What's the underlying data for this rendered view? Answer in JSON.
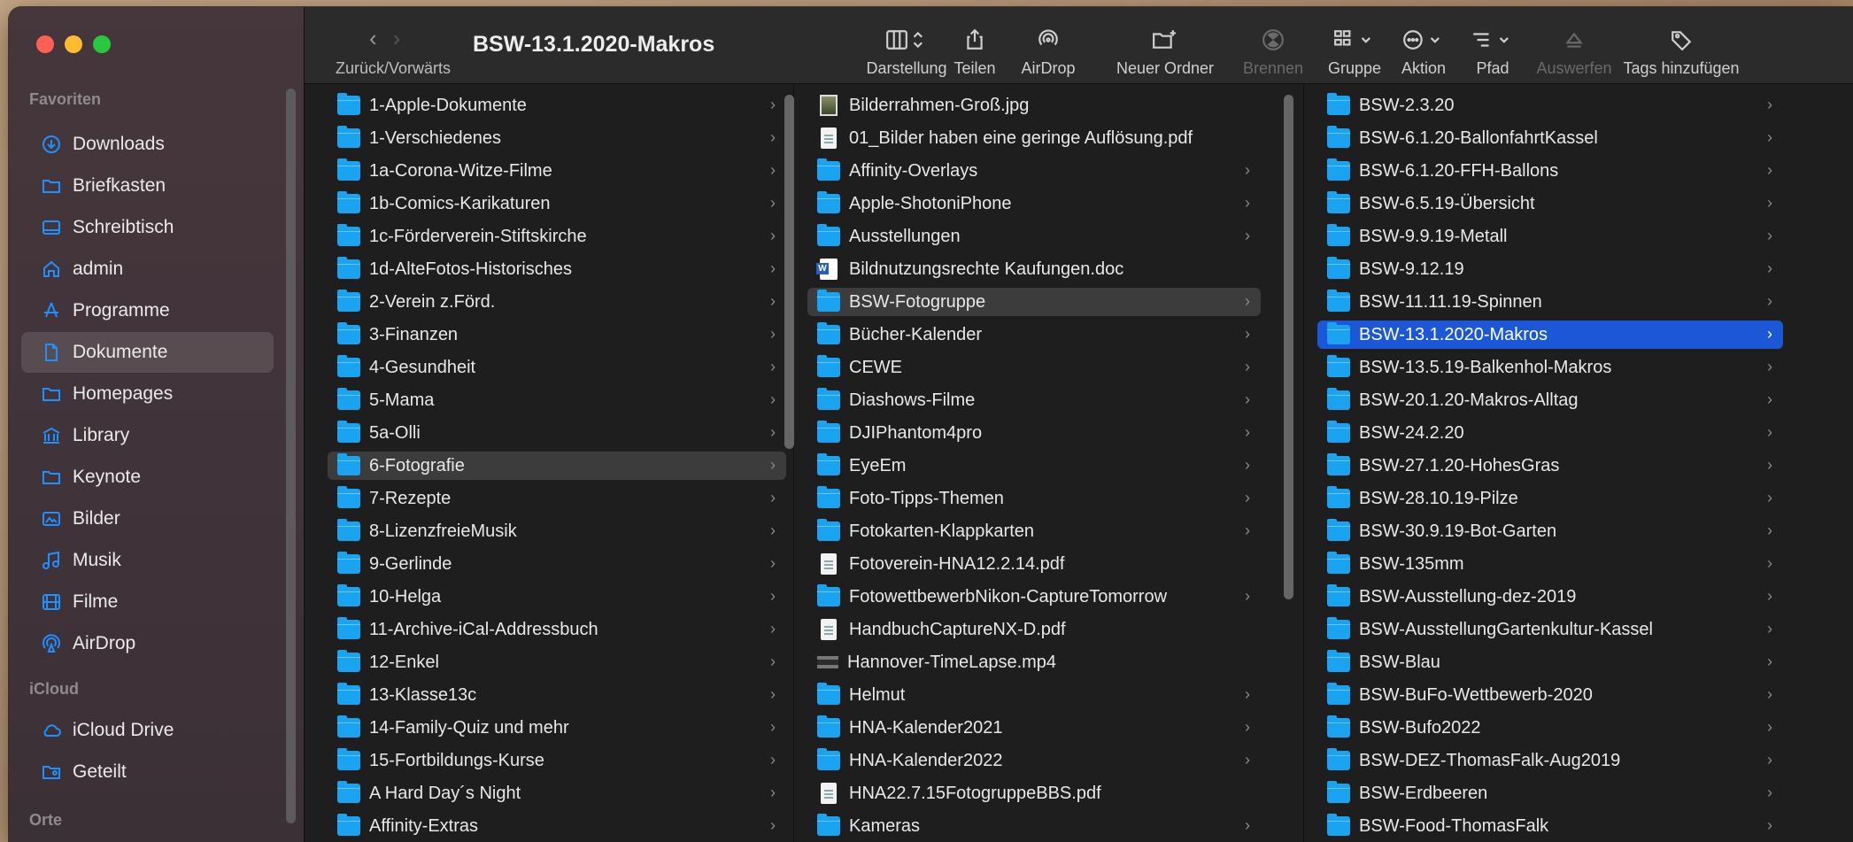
{
  "window": {
    "title": "BSW-13.1.2020-Makros"
  },
  "navigation": {
    "label": "Zurück/Vorwärts",
    "back_glyph": "‹",
    "forward_glyph": "›"
  },
  "toolbar": {
    "items": [
      {
        "name": "darstellung",
        "label": "Darstellung",
        "icon": "columns-view-icon",
        "disabled": false
      },
      {
        "name": "teilen",
        "label": "Teilen",
        "icon": "share-icon",
        "disabled": false
      },
      {
        "name": "airdrop",
        "label": "AirDrop",
        "icon": "airdrop-icon",
        "disabled": false
      },
      {
        "name": "neuer-ordner",
        "label": "Neuer Ordner",
        "icon": "new-folder-icon",
        "disabled": false
      },
      {
        "name": "brennen",
        "label": "Brennen",
        "icon": "burn-icon",
        "disabled": true
      },
      {
        "name": "gruppe",
        "label": "Gruppe",
        "icon": "group-icon",
        "disabled": false
      },
      {
        "name": "aktion",
        "label": "Aktion",
        "icon": "action-icon",
        "disabled": false
      },
      {
        "name": "pfad",
        "label": "Pfad",
        "icon": "path-icon",
        "disabled": false
      },
      {
        "name": "auswerfen",
        "label": "Auswerfen",
        "icon": "eject-icon",
        "disabled": true
      },
      {
        "name": "tags",
        "label": "Tags hinzufügen",
        "icon": "tag-icon",
        "disabled": false
      }
    ]
  },
  "sidebar": {
    "sections": [
      {
        "label": "Favoriten"
      },
      {
        "label": "iCloud"
      },
      {
        "label": "Orte"
      }
    ],
    "items": [
      {
        "label": "Downloads",
        "icon": "download-icon"
      },
      {
        "label": "Briefkasten",
        "icon": "folder-icon"
      },
      {
        "label": "Schreibtisch",
        "icon": "desktop-icon"
      },
      {
        "label": "admin",
        "icon": "home-icon"
      },
      {
        "label": "Programme",
        "icon": "apps-icon"
      },
      {
        "label": "Dokumente",
        "icon": "document-icon",
        "active": true
      },
      {
        "label": "Homepages",
        "icon": "folder-icon"
      },
      {
        "label": "Library",
        "icon": "library-icon"
      },
      {
        "label": "Keynote",
        "icon": "folder-icon"
      },
      {
        "label": "Bilder",
        "icon": "photo-icon"
      },
      {
        "label": "Musik",
        "icon": "music-icon"
      },
      {
        "label": "Filme",
        "icon": "film-icon"
      },
      {
        "label": "AirDrop",
        "icon": "airdrop-icon"
      },
      {
        "label": "iCloud Drive",
        "icon": "cloud-icon"
      },
      {
        "label": "Geteilt",
        "icon": "shared-folder-icon"
      }
    ]
  },
  "columns": {
    "col1": [
      {
        "label": "1-Apple-Dokumente",
        "type": "folder"
      },
      {
        "label": "1-Verschiedenes",
        "type": "folder"
      },
      {
        "label": "1a-Corona-Witze-Filme",
        "type": "folder"
      },
      {
        "label": "1b-Comics-Karikaturen",
        "type": "folder"
      },
      {
        "label": "1c-Förderverein-Stiftskirche",
        "type": "folder"
      },
      {
        "label": "1d-AlteFotos-Historisches",
        "type": "folder"
      },
      {
        "label": "2-Verein z.Förd.",
        "type": "folder"
      },
      {
        "label": "3-Finanzen",
        "type": "folder"
      },
      {
        "label": "4-Gesundheit",
        "type": "folder"
      },
      {
        "label": "5-Mama",
        "type": "folder"
      },
      {
        "label": "5a-Olli",
        "type": "folder"
      },
      {
        "label": "6-Fotografie",
        "type": "folder",
        "selected": "grey"
      },
      {
        "label": "7-Rezepte",
        "type": "folder"
      },
      {
        "label": "8-LizenzfreieMusik",
        "type": "folder"
      },
      {
        "label": "9-Gerlinde",
        "type": "folder"
      },
      {
        "label": "10-Helga",
        "type": "folder"
      },
      {
        "label": "11-Archive-iCal-Addressbuch",
        "type": "folder"
      },
      {
        "label": "12-Enkel",
        "type": "folder"
      },
      {
        "label": "13-Klasse13c",
        "type": "folder"
      },
      {
        "label": "14-Family-Quiz und mehr",
        "type": "folder"
      },
      {
        "label": "15-Fortbildungs-Kurse",
        "type": "folder"
      },
      {
        "label": "A Hard Day´s Night",
        "type": "folder"
      },
      {
        "label": "Affinity-Extras",
        "type": "folder"
      }
    ],
    "col2": [
      {
        "label": "Bilderrahmen-Groß.jpg",
        "type": "jpg"
      },
      {
        "label": "01_Bilder haben eine geringe Auflösung.pdf",
        "type": "pdf"
      },
      {
        "label": "Affinity-Overlays",
        "type": "folder"
      },
      {
        "label": "Apple-ShotoniPhone",
        "type": "folder"
      },
      {
        "label": "Ausstellungen",
        "type": "folder"
      },
      {
        "label": "Bildnutzungsrechte Kaufungen.doc",
        "type": "doc"
      },
      {
        "label": "BSW-Fotogruppe",
        "type": "folder",
        "selected": "grey"
      },
      {
        "label": "Bücher-Kalender",
        "type": "folder"
      },
      {
        "label": "CEWE",
        "type": "folder"
      },
      {
        "label": "Diashows-Filme",
        "type": "folder"
      },
      {
        "label": "DJIPhantom4pro",
        "type": "folder"
      },
      {
        "label": "EyeEm",
        "type": "folder"
      },
      {
        "label": "Foto-Tipps-Themen",
        "type": "folder"
      },
      {
        "label": "Fotokarten-Klappkarten",
        "type": "folder"
      },
      {
        "label": "Fotoverein-HNA12.2.14.pdf",
        "type": "pdf"
      },
      {
        "label": "FotowettbewerbNikon-CaptureTomorrow",
        "type": "folder"
      },
      {
        "label": "HandbuchCaptureNX-D.pdf",
        "type": "pdf"
      },
      {
        "label": "Hannover-TimeLapse.mp4",
        "type": "mp4"
      },
      {
        "label": "Helmut",
        "type": "folder"
      },
      {
        "label": "HNA-Kalender2021",
        "type": "folder"
      },
      {
        "label": "HNA-Kalender2022",
        "type": "folder"
      },
      {
        "label": "HNA22.7.15FotogruppeBBS.pdf",
        "type": "pdf"
      },
      {
        "label": "Kameras",
        "type": "folder"
      }
    ],
    "col3": [
      {
        "label": "BSW-2.3.20",
        "type": "folder"
      },
      {
        "label": "BSW-6.1.20-BallonfahrtKassel",
        "type": "folder"
      },
      {
        "label": "BSW-6.1.20-FFH-Ballons",
        "type": "folder"
      },
      {
        "label": "BSW-6.5.19-Übersicht",
        "type": "folder"
      },
      {
        "label": "BSW-9.9.19-Metall",
        "type": "folder"
      },
      {
        "label": "BSW-9.12.19",
        "type": "folder"
      },
      {
        "label": "BSW-11.11.19-Spinnen",
        "type": "folder"
      },
      {
        "label": "BSW-13.1.2020-Makros",
        "type": "folder",
        "selected": "blue"
      },
      {
        "label": "BSW-13.5.19-Balkenhol-Makros",
        "type": "folder"
      },
      {
        "label": "BSW-20.1.20-Makros-Alltag",
        "type": "folder"
      },
      {
        "label": "BSW-24.2.20",
        "type": "folder"
      },
      {
        "label": "BSW-27.1.20-HohesGras",
        "type": "folder"
      },
      {
        "label": "BSW-28.10.19-Pilze",
        "type": "folder"
      },
      {
        "label": "BSW-30.9.19-Bot-Garten",
        "type": "folder"
      },
      {
        "label": "BSW-135mm",
        "type": "folder"
      },
      {
        "label": "BSW-Ausstellung-dez-2019",
        "type": "folder"
      },
      {
        "label": "BSW-AusstellungGartenkultur-Kassel",
        "type": "folder"
      },
      {
        "label": "BSW-Blau",
        "type": "folder"
      },
      {
        "label": "BSW-BuFo-Wettbewerb-2020",
        "type": "folder"
      },
      {
        "label": "BSW-Bufo2022",
        "type": "folder"
      },
      {
        "label": "BSW-DEZ-ThomasFalk-Aug2019",
        "type": "folder"
      },
      {
        "label": "BSW-Erdbeeren",
        "type": "folder"
      },
      {
        "label": "BSW-Food-ThomasFalk",
        "type": "folder"
      }
    ]
  },
  "colors": {
    "accent": "#1b57d6",
    "folder": "#1aa3f0"
  }
}
